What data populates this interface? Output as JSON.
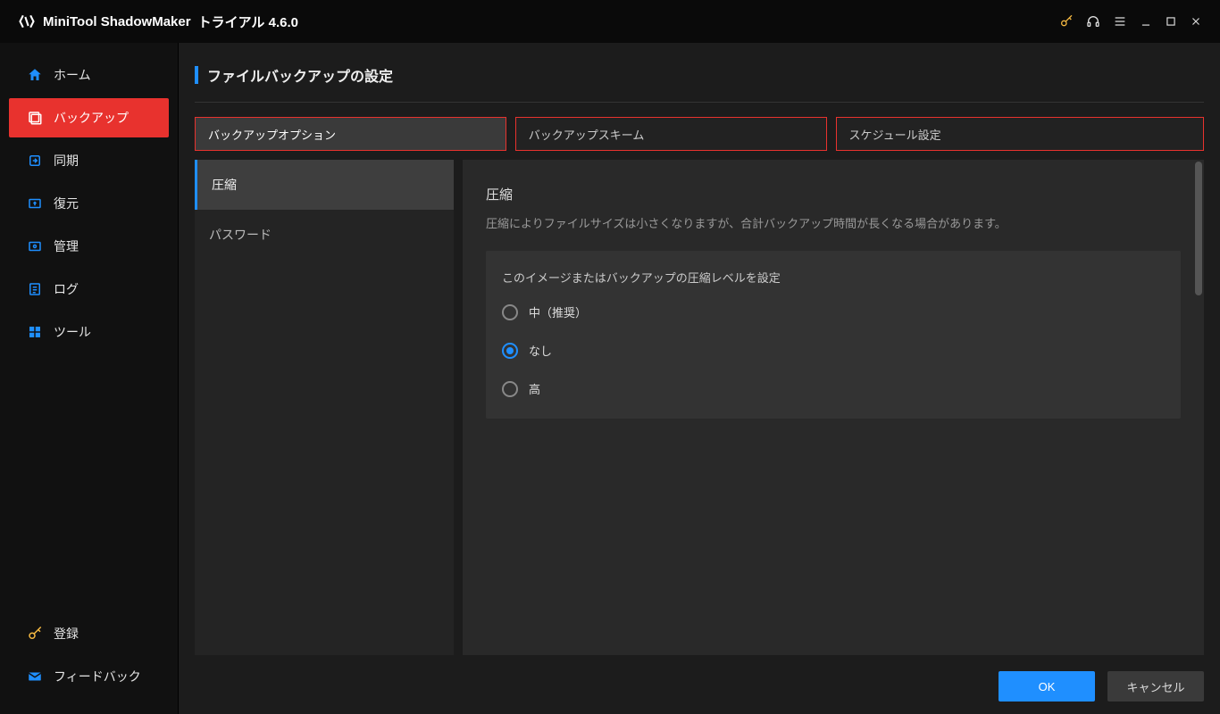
{
  "app": {
    "name": "MiniTool ShadowMaker",
    "edition": "トライアル 4.6.0"
  },
  "titlebar_icons": {
    "key": "key-icon",
    "headset": "headset-icon",
    "menu": "menu-icon",
    "minimize": "minimize-icon",
    "maximize": "maximize-icon",
    "close": "close-icon"
  },
  "sidebar": {
    "items": [
      {
        "label": "ホーム",
        "icon": "home-icon"
      },
      {
        "label": "バックアップ",
        "icon": "backup-icon"
      },
      {
        "label": "同期",
        "icon": "sync-icon"
      },
      {
        "label": "復元",
        "icon": "restore-icon"
      },
      {
        "label": "管理",
        "icon": "manage-icon"
      },
      {
        "label": "ログ",
        "icon": "log-icon"
      },
      {
        "label": "ツール",
        "icon": "tools-icon"
      }
    ],
    "active_index": 1,
    "bottom": [
      {
        "label": "登録",
        "icon": "register-key-icon"
      },
      {
        "label": "フィードバック",
        "icon": "feedback-mail-icon"
      }
    ]
  },
  "page": {
    "title": "ファイルバックアップの設定"
  },
  "tabs": {
    "items": [
      {
        "label": "バックアップオプション"
      },
      {
        "label": "バックアップスキーム"
      },
      {
        "label": "スケジュール設定"
      }
    ],
    "active_index": 0
  },
  "option_list": {
    "items": [
      {
        "label": "圧縮"
      },
      {
        "label": "パスワード"
      }
    ],
    "active_index": 0
  },
  "detail": {
    "title": "圧縮",
    "description": "圧縮によりファイルサイズは小さくなりますが、合計バックアップ時間が長くなる場合があります。",
    "group_title": "このイメージまたはバックアップの圧縮レベルを設定",
    "radios": [
      {
        "label": "中（推奨）"
      },
      {
        "label": "なし"
      },
      {
        "label": "高"
      }
    ],
    "selected_index": 1
  },
  "footer": {
    "ok": "OK",
    "cancel": "キャンセル"
  },
  "colors": {
    "accent_red": "#e8322e",
    "accent_blue": "#1f8fff",
    "key_gold": "#f5b942"
  }
}
